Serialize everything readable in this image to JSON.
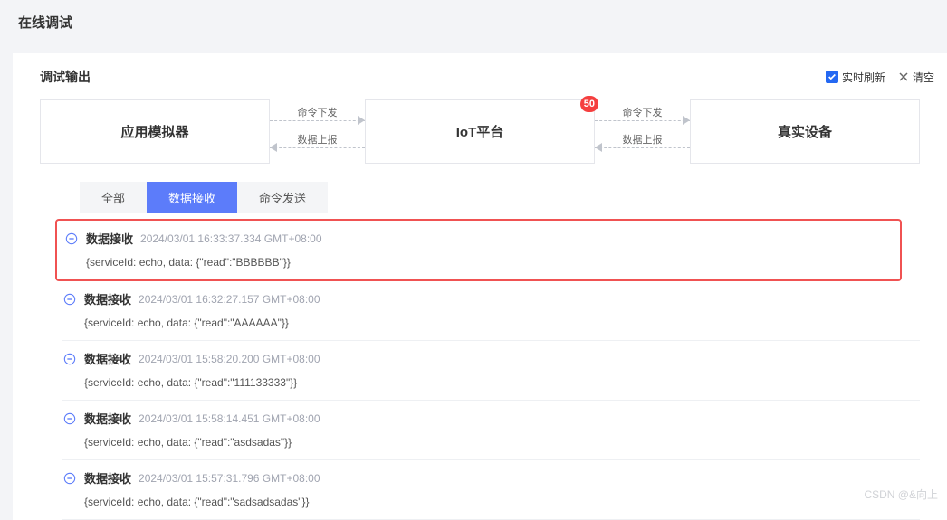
{
  "page_title": "在线调试",
  "output": {
    "title": "调试输出",
    "realtime_label": "实时刷新",
    "clear_label": "清空"
  },
  "flow": {
    "node_simulator": "应用模拟器",
    "node_platform": "IoT平台",
    "node_device": "真实设备",
    "cmd_down": "命令下发",
    "data_up": "数据上报",
    "badge": "50"
  },
  "tabs": {
    "all": "全部",
    "receive": "数据接收",
    "send": "命令发送"
  },
  "logs": [
    {
      "type": "数据接收",
      "time": "2024/03/01 16:33:37.334 GMT+08:00",
      "body": "{serviceId: echo, data: {\"read\":\"BBBBBB\"}}",
      "highlight": true
    },
    {
      "type": "数据接收",
      "time": "2024/03/01 16:32:27.157 GMT+08:00",
      "body": "{serviceId: echo, data: {\"read\":\"AAAAAA\"}}"
    },
    {
      "type": "数据接收",
      "time": "2024/03/01 15:58:20.200 GMT+08:00",
      "body": "{serviceId: echo, data: {\"read\":\"111133333\"}}"
    },
    {
      "type": "数据接收",
      "time": "2024/03/01 15:58:14.451 GMT+08:00",
      "body": "{serviceId: echo, data: {\"read\":\"asdsadas\"}}"
    },
    {
      "type": "数据接收",
      "time": "2024/03/01 15:57:31.796 GMT+08:00",
      "body": "{serviceId: echo, data: {\"read\":\"sadsadsadas\"}}"
    }
  ],
  "watermark": "CSDN @&向上"
}
